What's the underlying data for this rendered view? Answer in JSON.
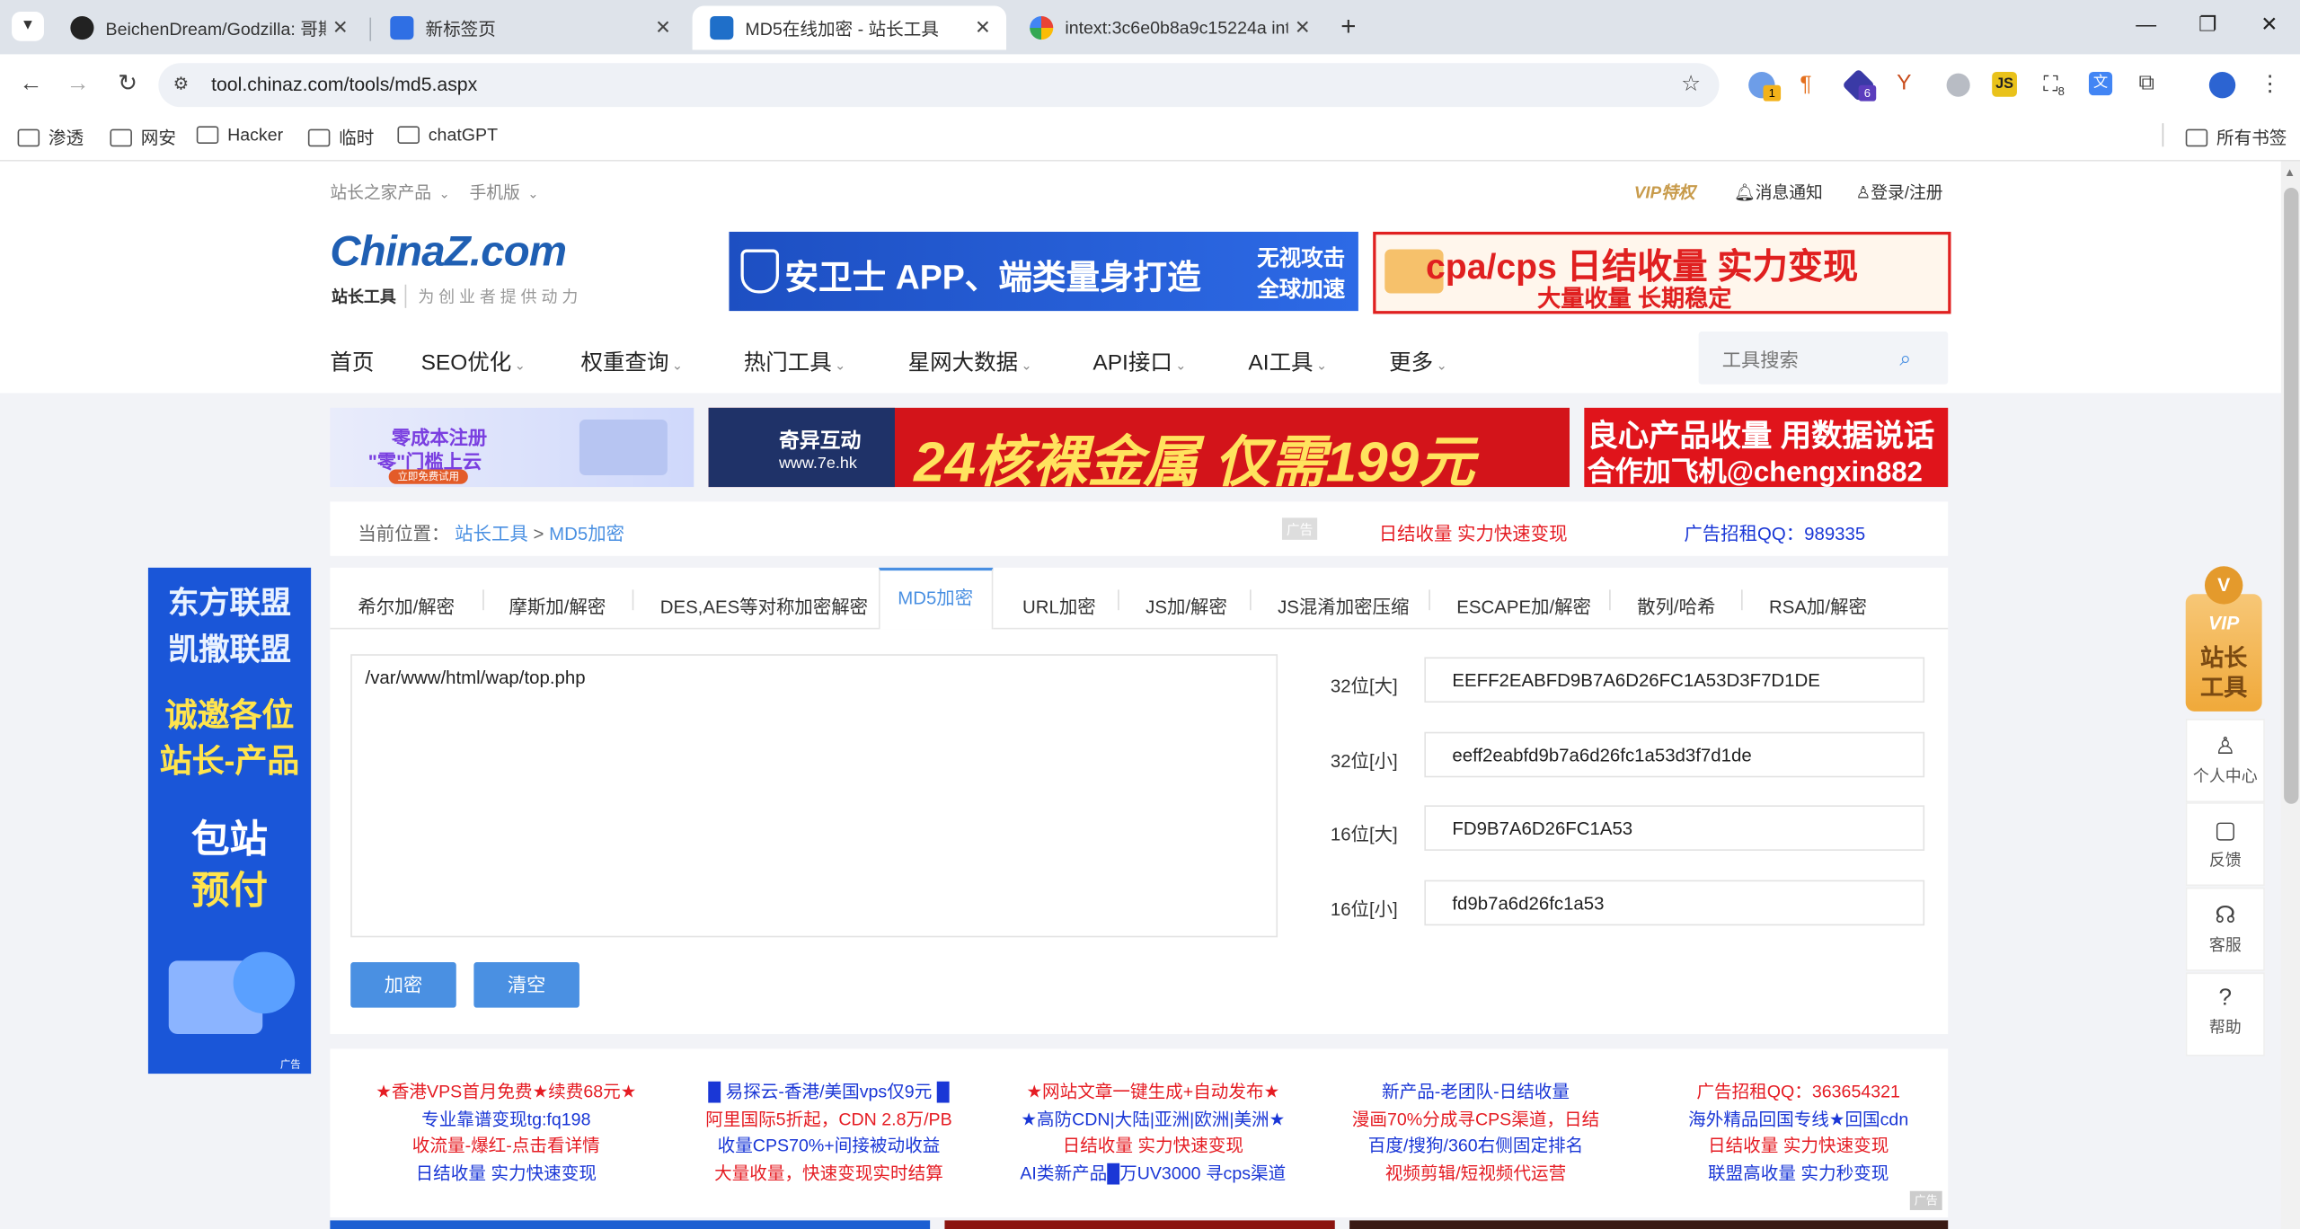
{
  "browser": {
    "tabs": [
      {
        "title": "BeichenDream/Godzilla: 哥斯"
      },
      {
        "title": "新标签页"
      },
      {
        "title": "MD5在线加密 - 站长工具"
      },
      {
        "title": "intext:3c6e0b8a9c15224a inte"
      }
    ],
    "url": "tool.chinaz.com/tools/md5.aspx",
    "bookmarks": [
      "渗透",
      "网安",
      "Hacker",
      "临时",
      "chatGPT"
    ],
    "all_bookmarks": "所有书签",
    "ext_badges": [
      "1",
      "6",
      "8"
    ]
  },
  "site": {
    "topbar": {
      "products": "站长之家产品",
      "mobile": "手机版",
      "vip": "VIP特权",
      "notify": "消息通知",
      "login": "登录/注册"
    },
    "logo": {
      "main": "ChinaZ.com",
      "sub1": "站长工具",
      "sub2": "为创业者提供动力"
    },
    "header_ads": {
      "ad1_main": "安卫士 APP、端类量身打造",
      "ad1_side1": "无视攻击",
      "ad1_side2": "全球加速",
      "ad2_main": "cpa/cps 日结收量 实力变现",
      "ad2_sub": "大量收量 长期稳定",
      "ad_tag": "广告"
    },
    "nav": [
      "首页",
      "SEO优化",
      "权重查询",
      "热门工具",
      "星网大数据",
      "API接口",
      "AI工具",
      "更多"
    ],
    "search_placeholder": "工具搜索",
    "banner_ads": {
      "b1_line1": "零成本注册",
      "b1_line2": "\"零\"门槛上云",
      "b1_btn": "立即免费试用",
      "b2_brand": "奇异互动",
      "b2_url": "www.7e.hk",
      "b2_text": "24核裸金属 仅需199元",
      "b3_line1": "良心产品收量 用数据说话",
      "b3_line2": "合作加飞机@chengxin882"
    },
    "breadcrumb": {
      "label": "当前位置：",
      "home": "站长工具",
      "sep": ">",
      "current": "MD5加密",
      "ad_tag": "广告",
      "promo": "日结收量 实力快速变现",
      "qq": "广告招租QQ：989335"
    },
    "tool_tabs": [
      "希尔加/解密",
      "摩斯加/解密",
      "DES,AES等对称加密解密",
      "MD5加密",
      "URL加密",
      "JS加/解密",
      "JS混淆加密压缩",
      "ESCAPE加/解密",
      "散列/哈希",
      "RSA加/解密"
    ],
    "input_text": "/var/www/html/wap/top.php",
    "results": [
      {
        "label": "32位[大]",
        "value": "EEFF2EABFD9B7A6D26FC1A53D3F7D1DE"
      },
      {
        "label": "32位[小]",
        "value": "eeff2eabfd9b7a6d26fc1a53d3f7d1de"
      },
      {
        "label": "16位[大]",
        "value": "FD9B7A6D26FC1A53"
      },
      {
        "label": "16位[小]",
        "value": "fd9b7a6d26fc1a53"
      }
    ],
    "buttons": {
      "encrypt": "加密",
      "clear": "清空"
    },
    "left_ad": [
      "东方联盟",
      "凯撒联盟",
      "诚邀各位",
      "站长-产品",
      "包站",
      "预付"
    ],
    "left_ad_tag": "广告",
    "text_ads": [
      [
        "★香港VPS首月免费★续费68元★",
        "专业靠谱变现tg:fq198",
        "收流量-爆红-点击看详情",
        "日结收量 实力快速变现"
      ],
      [
        "█ 易探云-香港/美国vps仅9元 █",
        "阿里国际5折起，CDN 2.8万/PB",
        "收量CPS70%+间接被动收益",
        "大量收量，快速变现实时结算"
      ],
      [
        "★网站文章一键生成+自动发布★",
        "★高防CDN|大陆|亚洲|欧洲|美洲★",
        "日结收量 实力快速变现",
        "AI类新产品█万UV3000 寻cps渠道"
      ],
      [
        "新产品-老团队-日结收量",
        "漫画70%分成寻CPS渠道，日结",
        "百度/搜狗/360右侧固定排名",
        "视频剪辑/短视频代运营"
      ],
      [
        "广告招租QQ：363654321",
        "海外精品回国专线★回国cdn",
        "日结收量 实力快速变现",
        "联盟高收量 实力秒变现"
      ]
    ],
    "text_ads_tag": "广告",
    "side_tools": {
      "vip1": "VIP",
      "vip2": "站长",
      "vip3": "工具",
      "personal": "个人中心",
      "feedback": "反馈",
      "service": "客服",
      "help": "帮助"
    }
  },
  "colors": {
    "accent": "#4a90e2",
    "ad_red": "#e51c23",
    "ad_blue": "#1a37d6"
  }
}
